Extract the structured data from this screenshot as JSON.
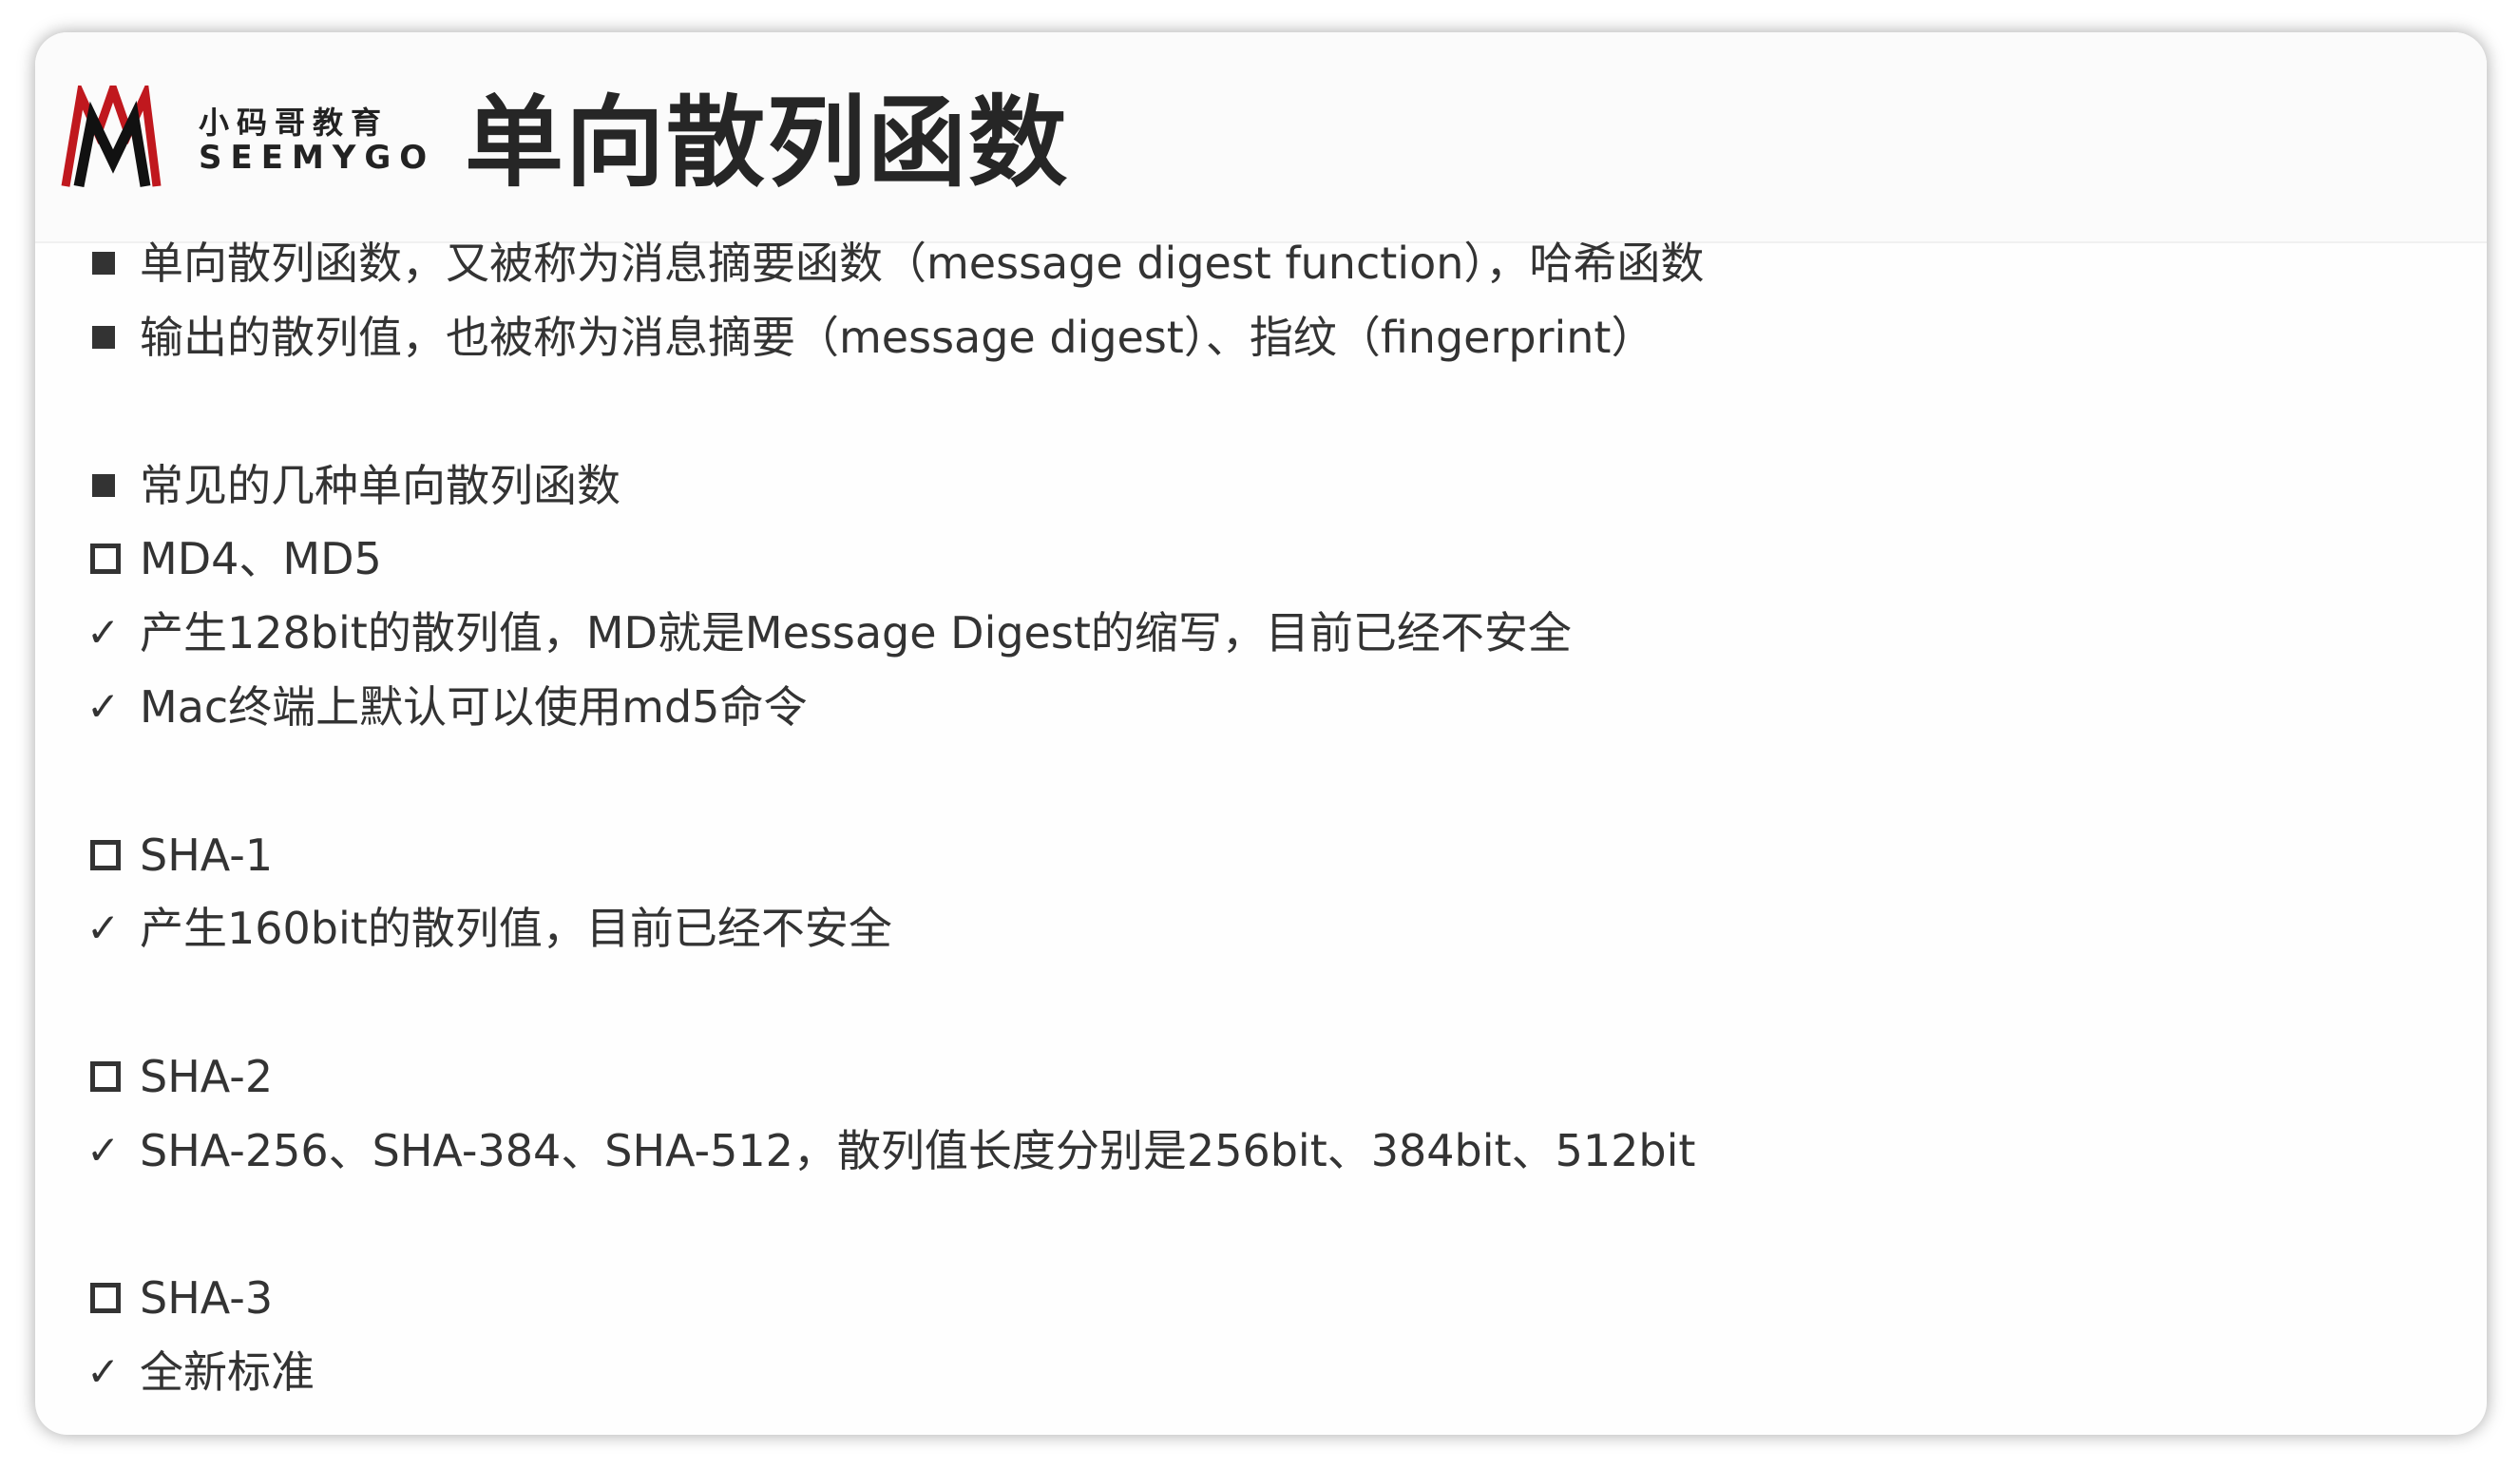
{
  "logo": {
    "cn": "小码哥教育",
    "en": "SEEMYGO"
  },
  "title": "单向散列函数",
  "lines": [
    {
      "type": "bullet",
      "text": "单向散列函数，又被称为消息摘要函数（message digest function），哈希函数"
    },
    {
      "type": "bullet",
      "text": "输出的散列值，也被称为消息摘要（message digest）、指纹（fingerprint）"
    },
    {
      "type": "bullet",
      "text": "常见的几种单向散列函数"
    },
    {
      "type": "box",
      "text": "MD4、MD5"
    },
    {
      "type": "check",
      "text": "产生128bit的散列值，MD就是Message Digest的缩写，目前已经不安全"
    },
    {
      "type": "check",
      "text": "Mac终端上默认可以使用md5命令"
    },
    {
      "type": "box",
      "text": "SHA-1"
    },
    {
      "type": "check",
      "text": "产生160bit的散列值，目前已经不安全"
    },
    {
      "type": "box",
      "text": "SHA-2"
    },
    {
      "type": "check",
      "text": "SHA-256、SHA-384、SHA-512，散列值长度分别是256bit、384bit、512bit"
    },
    {
      "type": "box",
      "text": "SHA-3"
    },
    {
      "type": "check",
      "text": "全新标准"
    }
  ],
  "check_glyph": "✓"
}
